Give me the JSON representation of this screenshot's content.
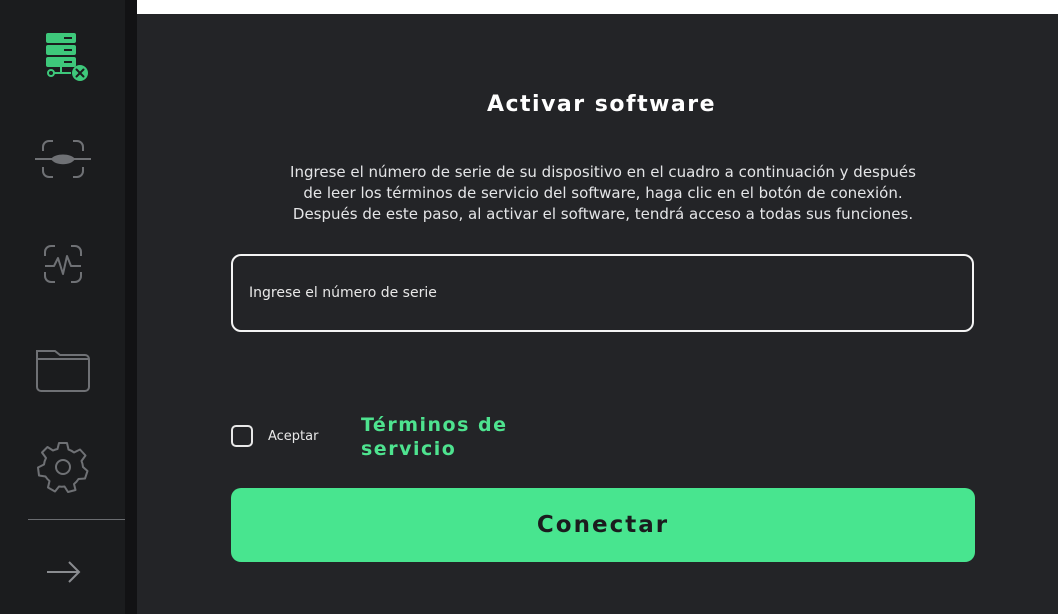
{
  "sidebar": {
    "items": [
      {
        "name": "server-disconnected",
        "icon": "server-disconnected-icon"
      },
      {
        "name": "scan",
        "icon": "scan-icon"
      },
      {
        "name": "pulse-monitor",
        "icon": "pulse-monitor-icon"
      },
      {
        "name": "files",
        "icon": "folder-icon"
      },
      {
        "name": "settings",
        "icon": "gear-icon"
      },
      {
        "name": "next",
        "icon": "arrow-right-icon"
      }
    ]
  },
  "main": {
    "title": "Activar software",
    "description": "Ingrese el número de serie de su dispositivo en el cuadro a continuación y después\nde leer los términos de servicio del software, haga clic en el botón de conexión.\nDespués de este paso, al activar el software, tendrá acceso a todas sus funciones.",
    "serial_input": {
      "placeholder": "Ingrese el número de serie",
      "value": ""
    },
    "accept_label": "Aceptar",
    "accept_checked": false,
    "terms_link": "Términos de servicio",
    "connect_label": "Conectar"
  },
  "colors": {
    "accent": "#48e58f",
    "error": "#2ecc71",
    "background": "#232427",
    "sidebar": "#1b1c1e"
  }
}
